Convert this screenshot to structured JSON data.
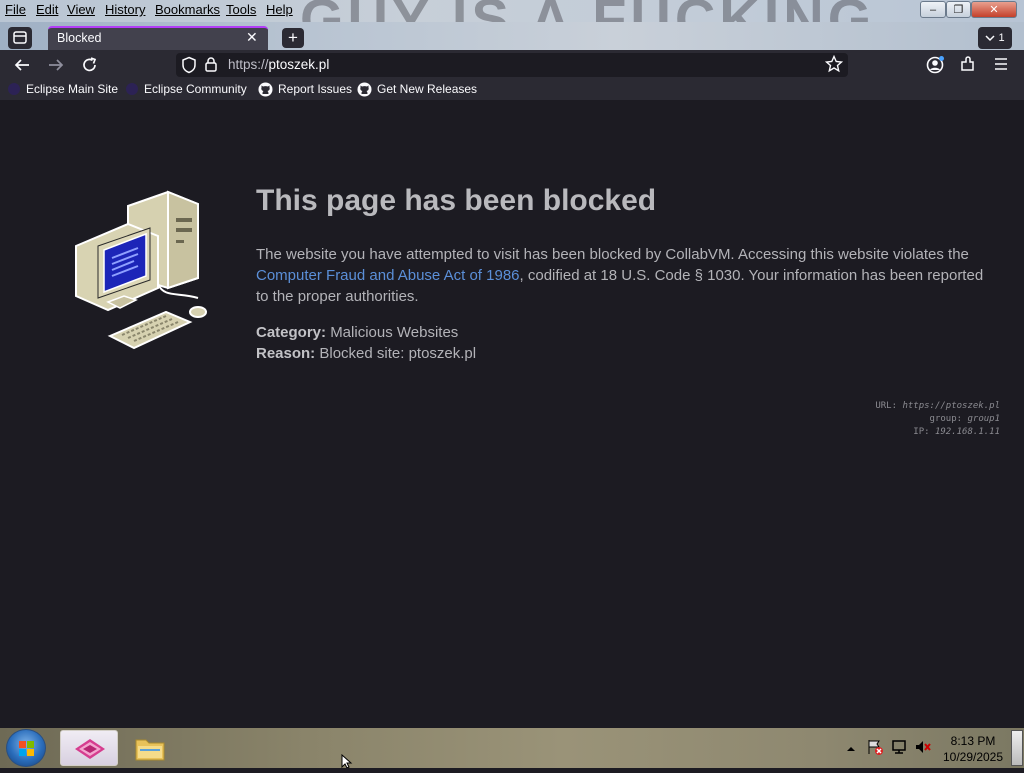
{
  "window": {
    "background_text": "GUY IS A FUCKING",
    "menu": [
      "File",
      "Edit",
      "View",
      "History",
      "Bookmarks",
      "Tools",
      "Help"
    ],
    "controls": {
      "minimize": "–",
      "restore": "❐",
      "close": "✕"
    }
  },
  "tabs": {
    "active_title": "Blocked",
    "close_glyph": "✕",
    "new_tab_glyph": "+",
    "all_tabs_count": "1"
  },
  "navbar": {
    "url_scheme": "https://",
    "url_host": "ptoszek.pl"
  },
  "bookmarks": [
    {
      "label": "Eclipse Main Site",
      "icon": "eclipse-icon"
    },
    {
      "label": "Eclipse Community",
      "icon": "eclipse-icon"
    },
    {
      "label": "Report Issues",
      "icon": "github-icon"
    },
    {
      "label": "Get New Releases",
      "icon": "github-icon"
    }
  ],
  "page": {
    "heading": "This page has been blocked",
    "para_before": "The website you have attempted to visit has been blocked by CollabVM. Accessing this website violates the ",
    "para_link": "Computer Fraud and Abuse Act of 1986",
    "para_after": ", codified at 18 U.S. Code § 1030. Your information has been reported to the proper authorities.",
    "category_label": "Category:",
    "category_value": "Malicious Websites",
    "reason_label": "Reason:",
    "reason_value": "Blocked site: ptoszek.pl",
    "meta": {
      "url_label": "URL:",
      "url_value": "https://ptoszek.pl",
      "group_label": "group:",
      "group_value": "group1",
      "ip_label": "IP:",
      "ip_value": "192.168.1.11"
    }
  },
  "taskbar": {
    "time": "8:13 PM",
    "date": "10/29/2025"
  },
  "colors": {
    "accent": "#b33ef7",
    "link": "#5b8fd8",
    "page_bg": "#1c1b22",
    "toolbar_bg": "#2b2a33"
  }
}
